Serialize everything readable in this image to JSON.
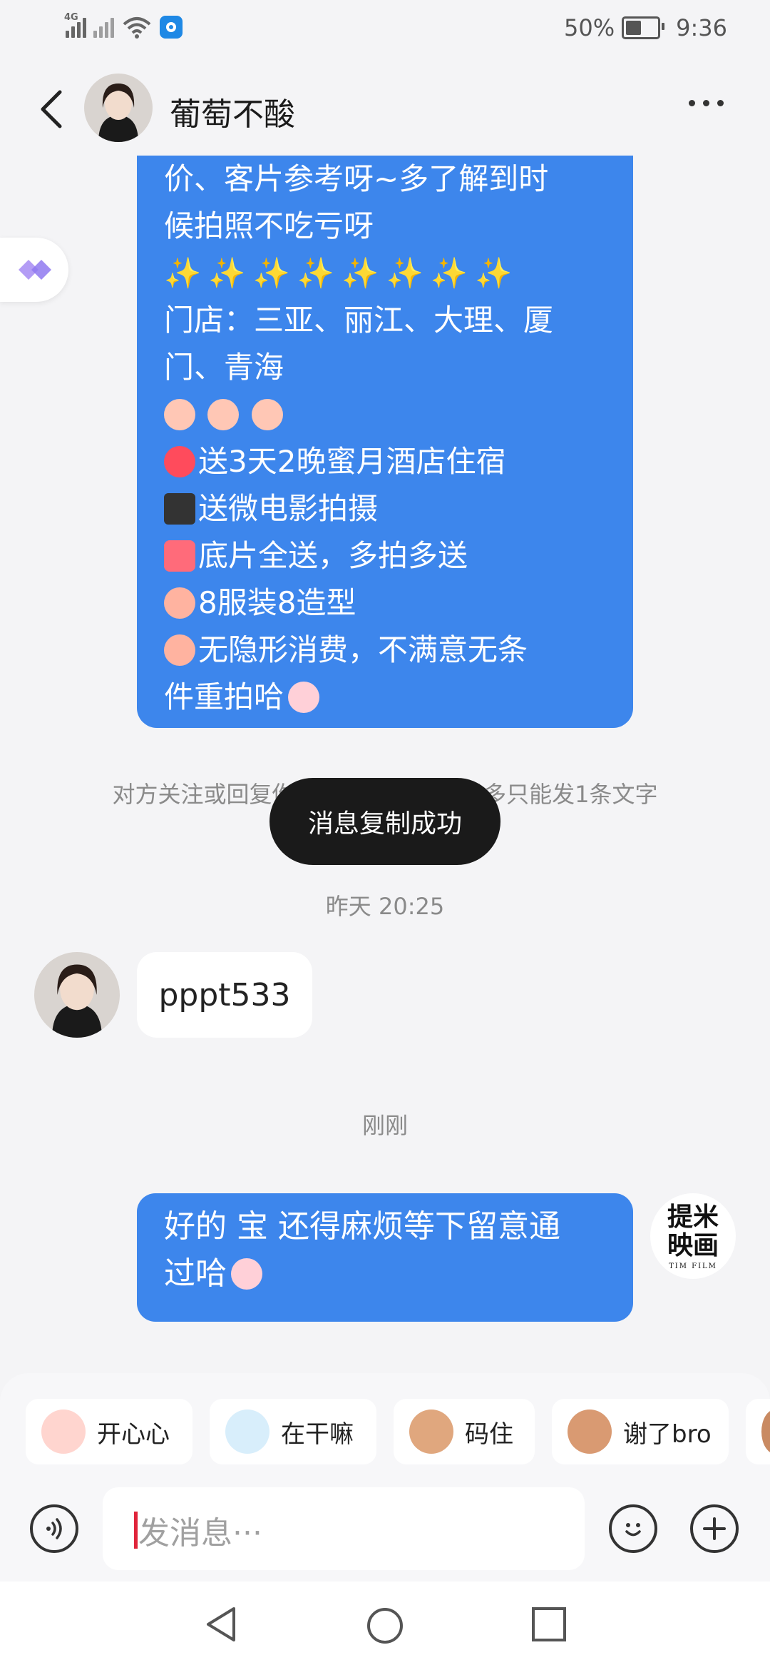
{
  "status_bar": {
    "network": "4G",
    "battery_percent": "50%",
    "battery_level": 0.5,
    "time": "9:36"
  },
  "header": {
    "contact_name": "葡萄不酸"
  },
  "messages": {
    "incoming_promo": {
      "lines": [
        "价、客片参考呀~多了解到时",
        "候拍照不吃亏呀",
        "✨✨✨✨✨✨✨✨",
        "门店：三亚、丽江、大理、厦",
        "门、青海",
        "送3天2晚蜜月酒店住宿",
        "送微电影拍摄",
        "底片全送，多拍多送",
        "8服装8造型",
        "无隐形消费，不满意无条",
        "件重拍哈"
      ]
    },
    "system_note": "对方关注或回复你之前，24小时内最多只能发1条文字",
    "toast": "消息复制成功",
    "timestamp_yesterday": "昨天 20:25",
    "incoming_reply": "pppt533",
    "timestamp_now": "刚刚",
    "outgoing": {
      "lines": [
        "好的 宝 还得麻烦等下留意通",
        "过哈"
      ]
    },
    "my_avatar_text": [
      "提米",
      "映画"
    ],
    "my_avatar_subtext": "TIM FILM"
  },
  "quick_replies": [
    "开心心",
    "在干嘛",
    "码住",
    "谢了bro"
  ],
  "composer": {
    "placeholder": "发消息···"
  },
  "colors": {
    "bubble_blue": "#3d86ec",
    "background": "#f4f4f6",
    "toast": "#1a1a1a"
  }
}
